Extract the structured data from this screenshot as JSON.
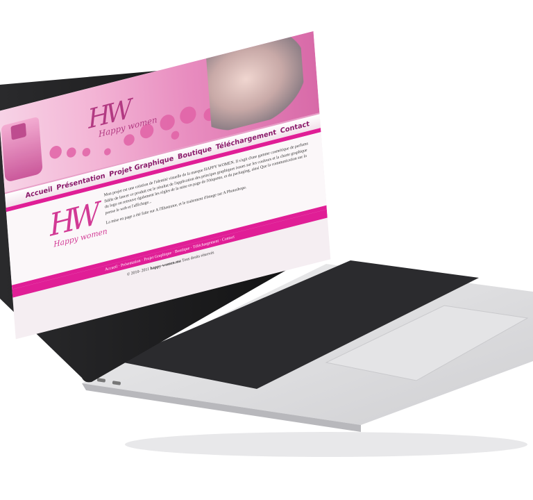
{
  "site": {
    "logo_monogram": "HW",
    "logo_name": "Happy women",
    "nav": [
      "Accueil",
      "Présentation",
      "Projet Graphique",
      "Boutique",
      "Téléchargement",
      "Contact"
    ],
    "paragraphs": [
      "Mon projet est une création de l'identité visuelle de la marque HAPPY WOMEN. Il s'agit d'une gamme cosmétique de parfums fidèle de lancer ce produit est le résultat de l'application des principes graphiques issues sur les couleurs et la charte graphique du logo on retrouve également les règles de la mise en page de l'étiquette, et du packaging, ainsi Que la communication sur la presse le web et l'affichage...",
      "La mise en page a été faite sur A l'Illustrator, et le traitement d'image sur A Photoshope."
    ],
    "footer_links": "Accueil · Présentation · Projet Graphique · Boutique · Téléchargement · Contact",
    "copyright_prefix": "© 2010- 2011 ",
    "copyright_site": "happy-women.ma",
    "copyright_suffix": " Tous droits réservés"
  },
  "colors": {
    "accent": "#e01e96",
    "brand": "#b23a82",
    "laptop_body": "#d9d9db"
  }
}
